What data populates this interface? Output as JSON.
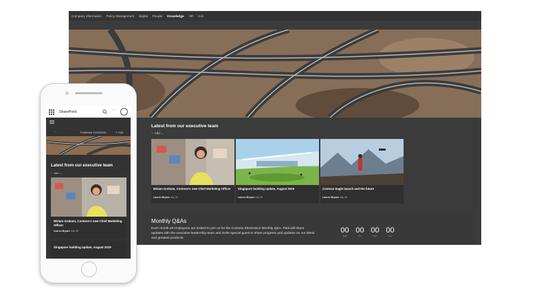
{
  "desktop": {
    "nav": [
      "Company information",
      "Policy Management",
      "Digital",
      "People",
      "Knowledge",
      "HR",
      "Edit"
    ],
    "section_title": "Latest from our executive team",
    "add_label": "Add",
    "cards": [
      {
        "title": "Miriam Graham, Contoso's new Chief Marketing Officer",
        "author": "Lauren Bryant",
        "date": "July 28"
      },
      {
        "title": "Singapore building update, August 2019",
        "author": "Lauren Bryant",
        "date": "July 28"
      },
      {
        "title": "Contoso Eagle launch and the future",
        "author": "Lauren Bryant",
        "date": "July 28"
      }
    ],
    "qa": {
      "title": "Monthly Q&As",
      "body": "Each month all employees are invited to join us for the Contoso Electronics Monthly Q&A. Patti will share updates with the executive leadership team and invite special guest to share progress and updates on our latest and greatest products.",
      "timer": [
        {
          "value": "00",
          "label": "days"
        },
        {
          "value": "00",
          "label": "hrs"
        },
        {
          "value": "00",
          "label": "mins"
        },
        {
          "value": "00",
          "label": "sec"
        }
      ]
    }
  },
  "phone": {
    "app_name": "SharePoint",
    "published": "Published 10/22/2020",
    "edit_label": "Edit",
    "section_title": "Latest from our executive team",
    "add_label": "Add",
    "card": {
      "title": "Miriam Graham, Contoso's new Chief Marketing Officer",
      "author": "Lauren Bryant",
      "date": "July 28"
    },
    "card2_title": "Singapore building update, August 2019"
  }
}
